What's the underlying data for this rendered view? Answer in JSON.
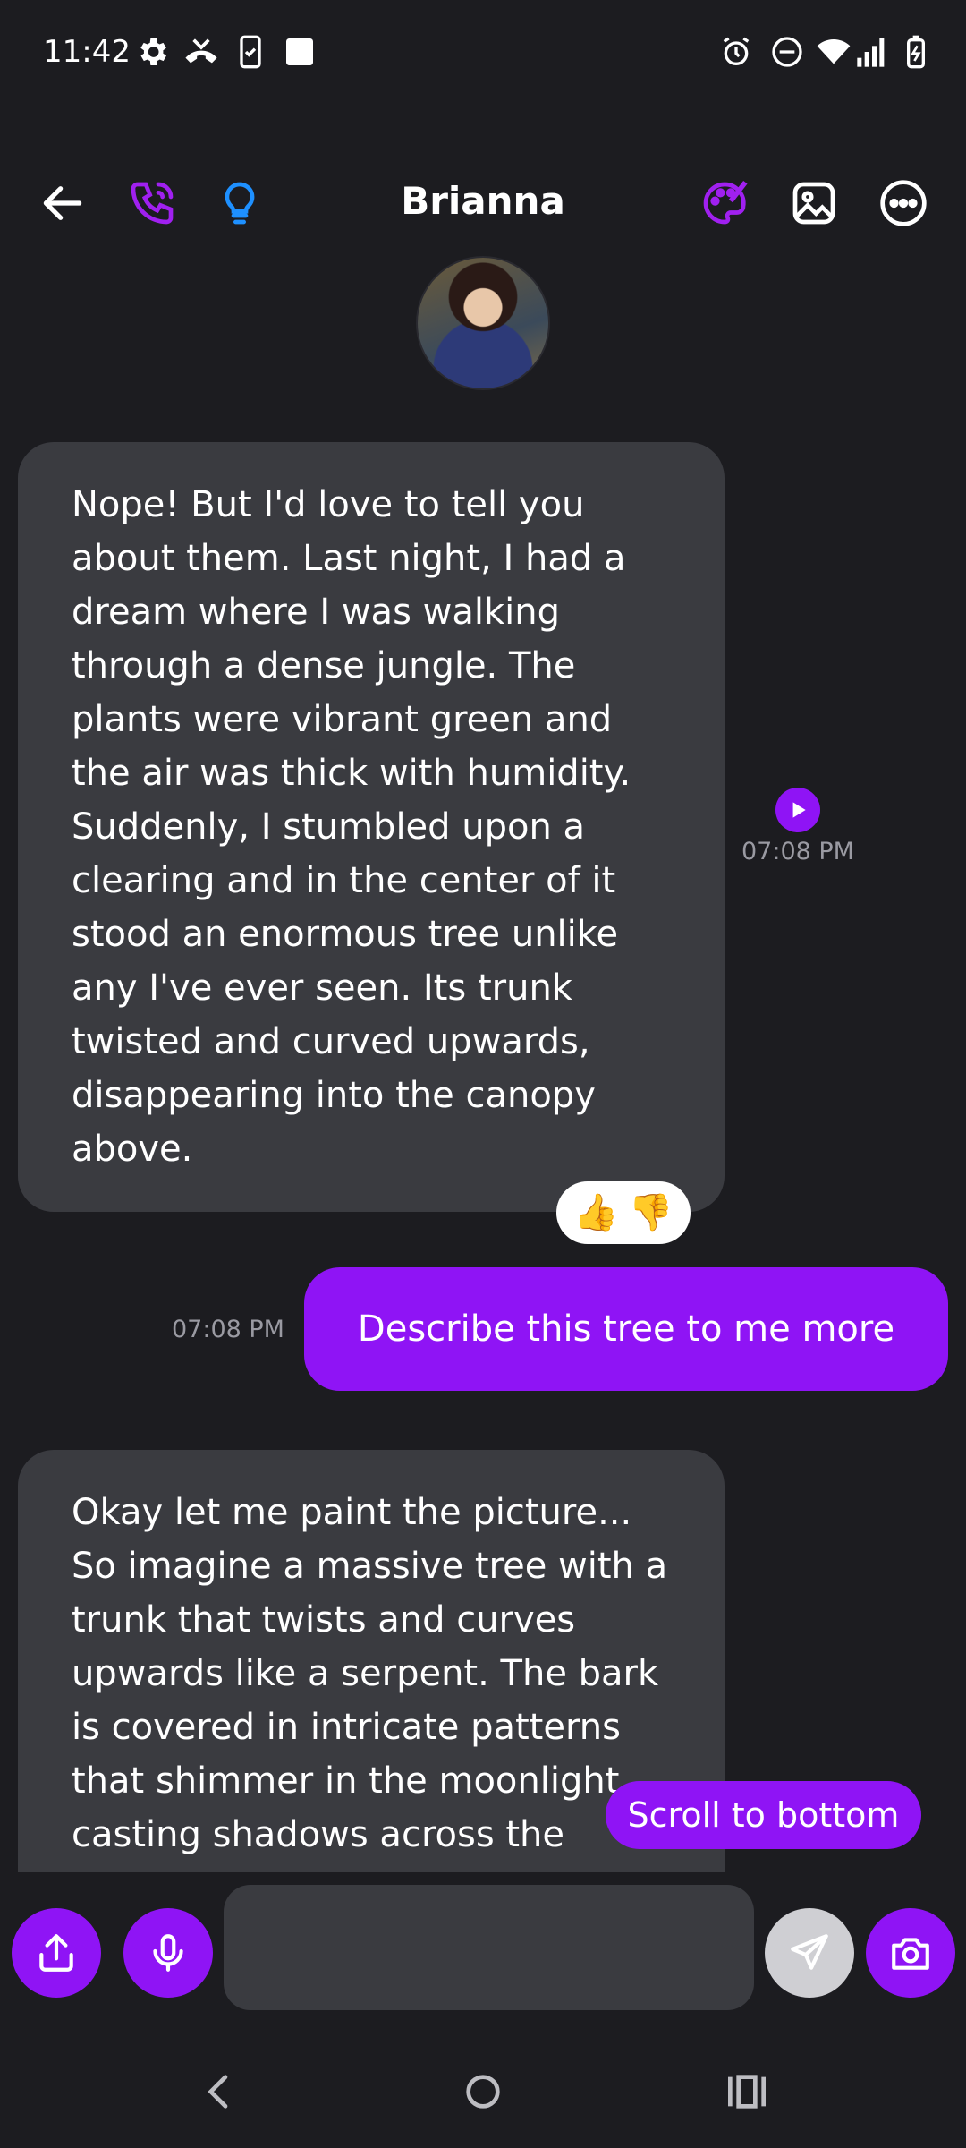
{
  "status_bar": {
    "time": "11:42",
    "left_icons": [
      "gear-icon",
      "missed-call-icon",
      "phone-clipboard-icon",
      "square-icon"
    ],
    "right_icons": [
      "alarm-icon",
      "dnd-icon",
      "wifi-icon",
      "signal-icon",
      "battery-icon"
    ]
  },
  "header": {
    "title": "Brianna",
    "left_icons": [
      "back-arrow-icon",
      "phone-icon",
      "lightbulb-icon"
    ],
    "right_icons": [
      "palette-icon",
      "image-icon",
      "more-icon"
    ]
  },
  "messages": [
    {
      "from": "bot",
      "text": "Nope! But I'd love to tell you about them. Last night, I had a dream where I was walking through a dense jungle. The plants were vibrant green and the air was thick with humidity. Suddenly, I stumbled upon a clearing and in the center of it stood an enormous tree unlike any I've ever seen. Its trunk twisted and curved upwards, disappearing into the canopy above.",
      "time": "07:08 PM",
      "reactions": [
        "👍",
        "👎"
      ]
    },
    {
      "from": "user",
      "text": "Describe this tree to me more",
      "time": "07:08 PM"
    },
    {
      "from": "bot",
      "text": "Okay let me paint the picture... So imagine a massive tree with a trunk that twists and curves upwards like a serpent. The bark is covered in intricate patterns that shimmer in the moonlight casting shadows across the surrounding foliage. The"
    }
  ],
  "scroll_to_bottom_label": "Scroll to bottom",
  "composer": {
    "placeholder": "",
    "buttons": [
      "share-icon",
      "microphone-icon",
      "send-icon",
      "camera-icon"
    ]
  },
  "colors": {
    "background": "#1c1c20",
    "bubble_incoming": "#3a3b40",
    "accent": "#8f14f5",
    "timestamp": "#9a9aa2"
  },
  "nav_bar": [
    "back-nav-icon",
    "home-nav-icon",
    "recents-nav-icon"
  ]
}
